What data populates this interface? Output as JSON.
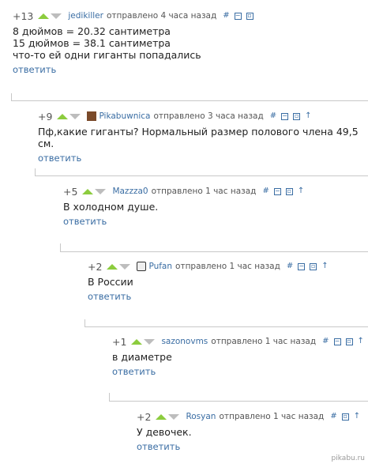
{
  "comments": [
    {
      "rating": "+13",
      "user": "jedikiller",
      "meta": "отправлено  4 часа назад",
      "lines": [
        "8 дюймов = 20.32 сантиметра",
        "15 дюймов = 38.1 сантиметра",
        "что-то ей одни гиганты попадались"
      ],
      "reply": "ответить"
    },
    {
      "rating": "+9",
      "user": "Pikabuwnica",
      "meta": "отправлено  3 часа назад",
      "lines": [
        "Пф,какие гиганты? Нормальный размер полового члена 49,5 см."
      ],
      "reply": "ответить"
    },
    {
      "rating": "+5",
      "user": "Mazzza0",
      "meta": "отправлено  1 час назад",
      "lines": [
        "В холодном душе."
      ],
      "reply": "ответить"
    },
    {
      "rating": "+2",
      "user": "Pufan",
      "meta": "отправлено  1 час назад",
      "lines": [
        "В России"
      ],
      "reply": "ответить"
    },
    {
      "rating": "+1",
      "user": "sazonovms",
      "meta": "отправлено  1 час назад",
      "lines": [
        "в диаметре"
      ],
      "reply": "ответить"
    },
    {
      "rating": "+2",
      "user": "Rosyan",
      "meta": "отправлено  1 час назад",
      "lines": [
        "У девочек."
      ],
      "reply": "ответить"
    }
  ],
  "icons": {
    "hash": "#",
    "collapse": "⊟",
    "save": "⎙",
    "parent": "↑"
  },
  "watermark": "pikabu.ru"
}
